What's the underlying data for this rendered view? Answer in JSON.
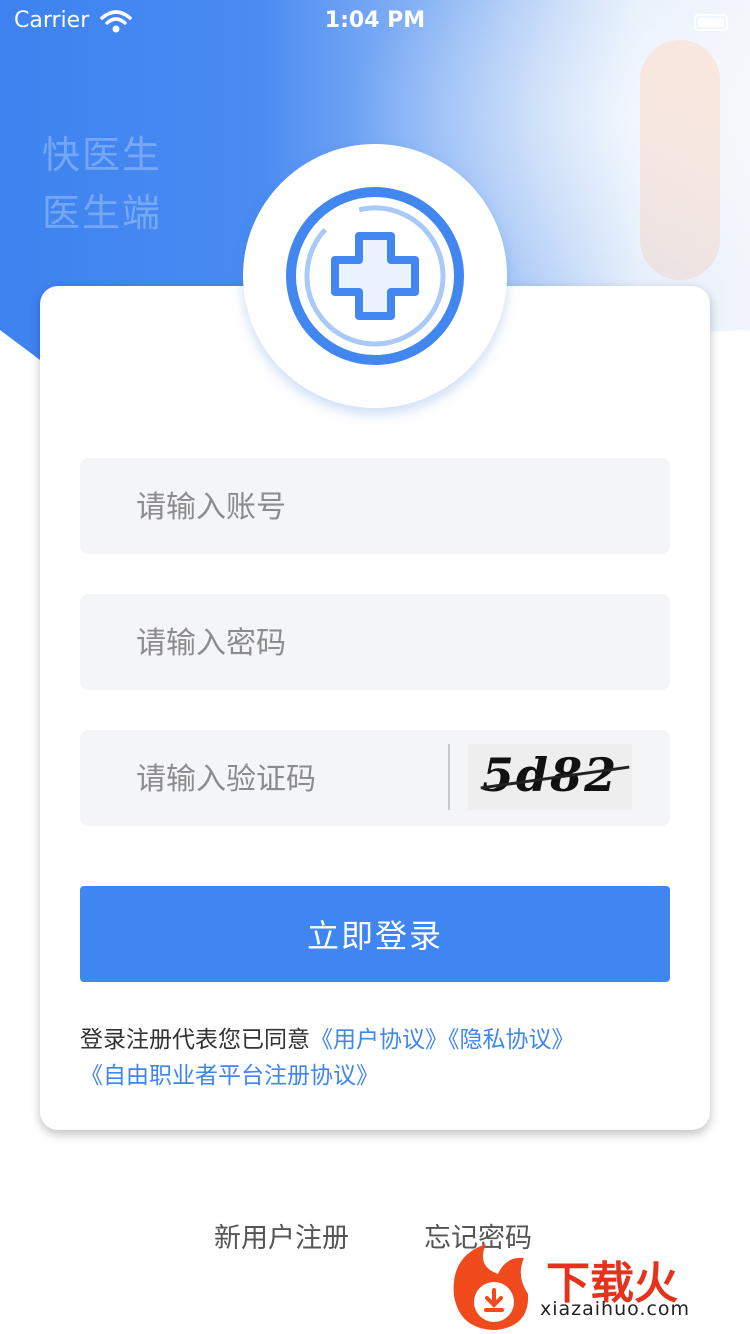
{
  "status_bar": {
    "carrier": "Carrier",
    "time": "1:04 PM"
  },
  "hero": {
    "slogan_line1": "快医生",
    "slogan_line2": "医生端"
  },
  "form": {
    "account_placeholder": "请输入账号",
    "password_placeholder": "请输入密码",
    "captcha_placeholder": "请输入验证码",
    "captcha_code": "5d82",
    "login_label": "立即登录"
  },
  "agreement": {
    "prefix": "登录注册代表您已同意",
    "user_agreement": "《用户协议》",
    "privacy_agreement": "《隐私协议》",
    "freelancer_agreement": "《自由职业者平台注册协议》"
  },
  "bottom": {
    "register": "新用户注册",
    "forgot": "忘记密码"
  },
  "watermark": {
    "brand": "下载火",
    "url": "xiazaihuo.com"
  },
  "colors": {
    "primary": "#3f86f2",
    "field_bg": "#f4f5f7"
  },
  "icons": [
    "wifi-icon",
    "battery-icon",
    "medical-cross-icon",
    "download-flame-icon"
  ]
}
